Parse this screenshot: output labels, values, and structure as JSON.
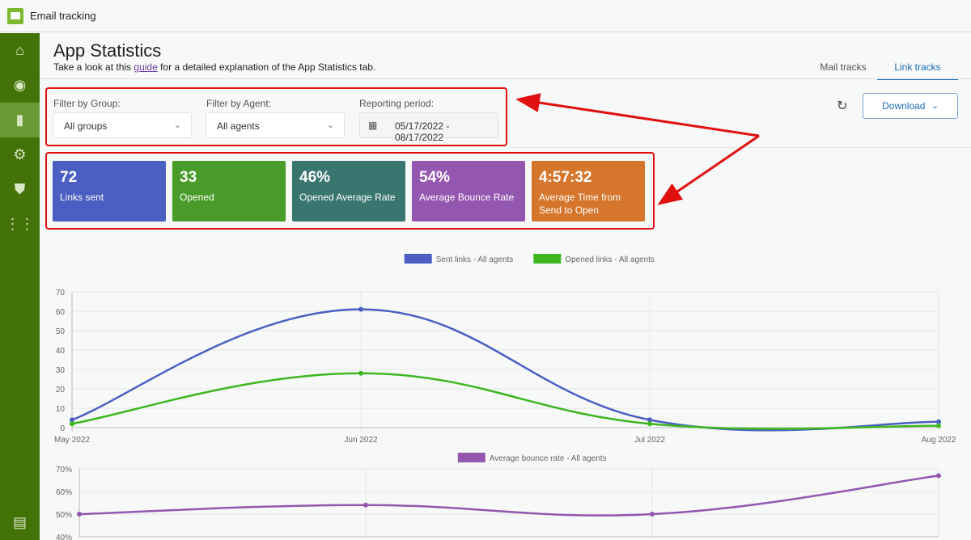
{
  "app": {
    "title": "Email tracking"
  },
  "sidebar": {
    "items": [
      {
        "name": "home",
        "icon": "⌂"
      },
      {
        "name": "tracking",
        "icon": "◉"
      },
      {
        "name": "statistics",
        "icon": "▮"
      },
      {
        "name": "settings",
        "icon": "⚙"
      },
      {
        "name": "security",
        "icon": "⛊"
      },
      {
        "name": "apps",
        "icon": "⋮⋮"
      }
    ],
    "feedback_icon": "▤"
  },
  "header": {
    "title": "App Statistics",
    "subtitle_pre": "Take a look at this ",
    "subtitle_link": "guide",
    "subtitle_post": " for a detailed explanation of the App Statistics tab."
  },
  "tabs": [
    {
      "label": "Mail tracks"
    },
    {
      "label": "Link tracks",
      "active": true
    }
  ],
  "filters": {
    "group_label": "Filter by Group:",
    "group_value": "All groups",
    "agent_label": "Filter by Agent:",
    "agent_value": "All agents",
    "period_label": "Reporting period:",
    "period_value": "05/17/2022 - 08/17/2022"
  },
  "toolbar": {
    "download_label": "Download"
  },
  "cards": [
    {
      "value": "72",
      "label": "Links sent",
      "color": "#4a5fc1"
    },
    {
      "value": "33",
      "label": "Opened",
      "color": "#4a9c2a"
    },
    {
      "value": "46%",
      "label": "Opened Average Rate",
      "color": "#3a7670"
    },
    {
      "value": "54%",
      "label": "Average Bounce Rate",
      "color": "#9457b0"
    },
    {
      "value": "4:57:32",
      "label": "Average Time from Send to Open",
      "color": "#d6762c"
    }
  ],
  "chart_data": [
    {
      "type": "line",
      "categories": [
        "May 2022",
        "Jun 2022",
        "Jul 2022",
        "Aug 2022"
      ],
      "ylim": [
        0,
        70
      ],
      "yticks": [
        "0",
        "10",
        "20",
        "30",
        "40",
        "50",
        "60",
        "70"
      ],
      "legend": "top",
      "series": [
        {
          "name": "Sent links - All agents",
          "color": "#4a5fc1",
          "values": [
            4,
            61,
            4,
            3
          ]
        },
        {
          "name": "Opened links - All agents",
          "color": "#3db61f",
          "values": [
            2,
            28,
            2,
            1
          ]
        }
      ]
    },
    {
      "type": "line",
      "categories": [
        "May 2022",
        "Jun 2022",
        "Jul 2022",
        "Aug 2022"
      ],
      "ylim": [
        40,
        70
      ],
      "yticks": [
        "40%",
        "50%",
        "60%",
        "70%"
      ],
      "legend": "top",
      "series": [
        {
          "name": "Average bounce rate - All agents",
          "color": "#9457b0",
          "values": [
            50,
            54,
            50,
            67
          ]
        }
      ]
    }
  ]
}
